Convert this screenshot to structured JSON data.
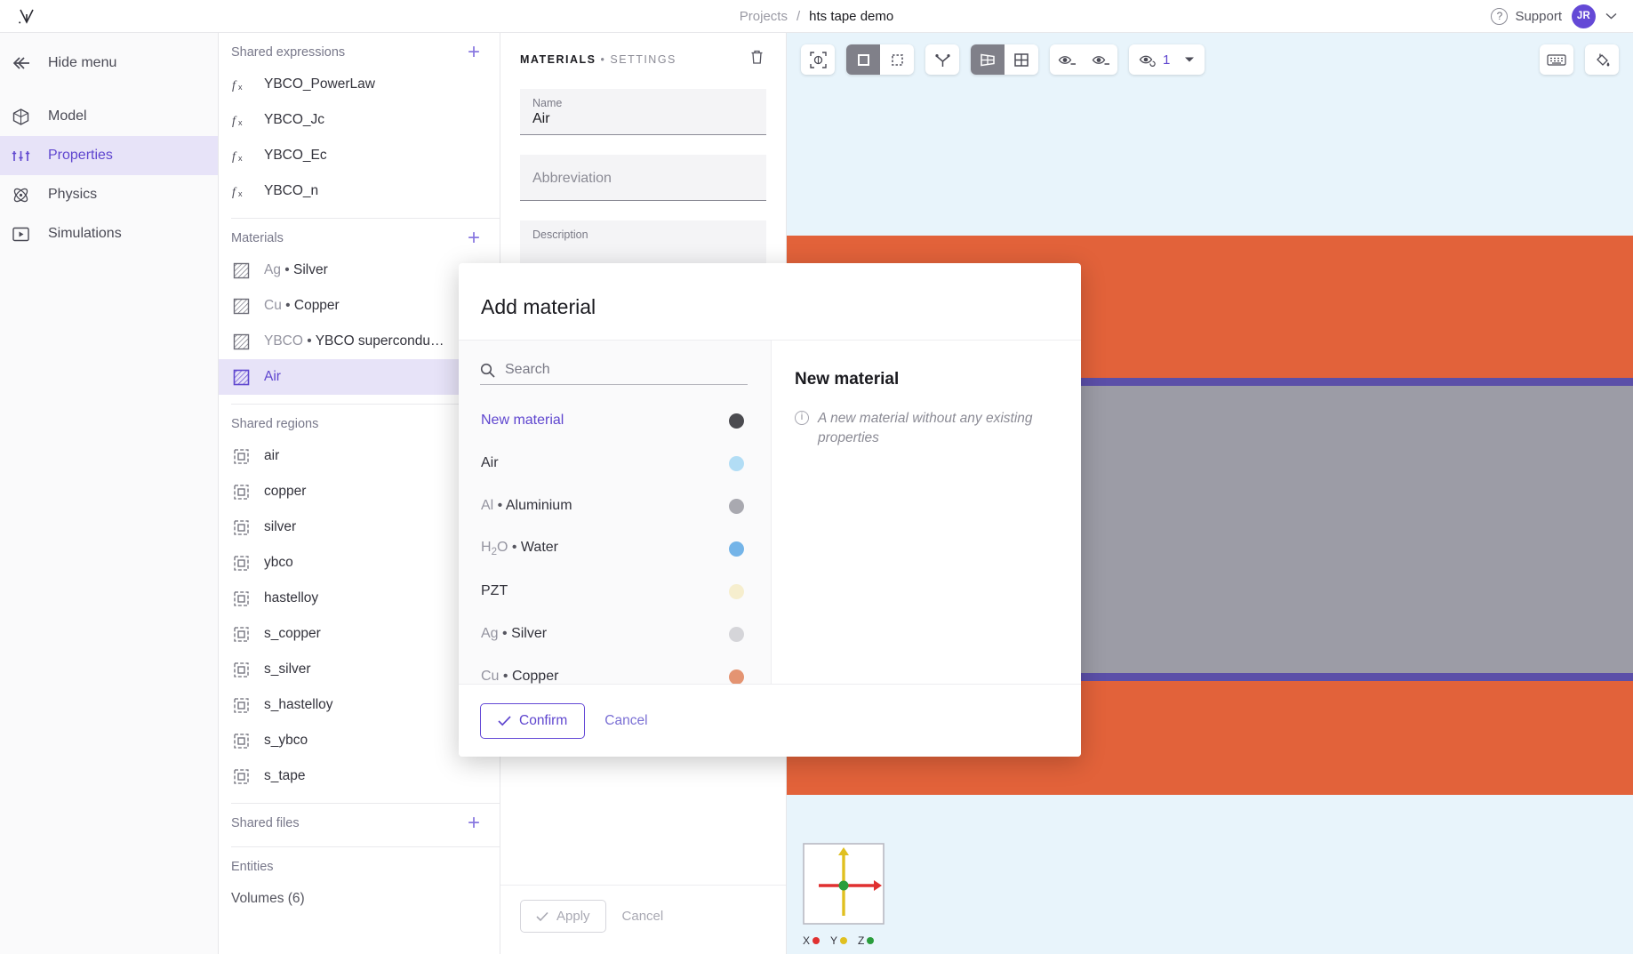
{
  "topbar": {
    "logo_icon": "vector-logo-icon",
    "breadcrumb": {
      "projects": "Projects",
      "separator": "/",
      "current": "hts tape demo"
    },
    "support_label": "Support",
    "help_icon": "question-circle-icon",
    "avatar_initials": "JR",
    "account_caret_icon": "chevron-down-icon"
  },
  "nav": {
    "hide_menu": "Hide menu",
    "items": [
      {
        "label": "Model",
        "icon": "cube-icon",
        "active": false
      },
      {
        "label": "Properties",
        "icon": "sliders-icon",
        "active": true
      },
      {
        "label": "Physics",
        "icon": "atom-icon",
        "active": false
      },
      {
        "label": "Simulations",
        "icon": "play-box-icon",
        "active": false
      }
    ]
  },
  "tree": {
    "sections": [
      {
        "title": "Shared expressions",
        "add_icon": "plus-icon",
        "items": [
          {
            "label": "YBCO_PowerLaw",
            "icon": "fx-icon"
          },
          {
            "label": "YBCO_Jc",
            "icon": "fx-icon"
          },
          {
            "label": "YBCO_Ec",
            "icon": "fx-icon"
          },
          {
            "label": "YBCO_n",
            "icon": "fx-icon"
          }
        ]
      },
      {
        "title": "Materials",
        "add_icon": "plus-icon",
        "items": [
          {
            "symbol": "Ag",
            "label": "Silver",
            "icon": "hatch-square-icon",
            "selected": false
          },
          {
            "symbol": "Cu",
            "label": "Copper",
            "icon": "hatch-square-icon",
            "selected": false
          },
          {
            "symbol": "YBCO",
            "label": "YBCO supercondu…",
            "icon": "hatch-square-icon",
            "selected": false
          },
          {
            "symbol": "",
            "label": "Air",
            "icon": "hatch-square-icon",
            "selected": true
          }
        ]
      },
      {
        "title": "Shared regions",
        "items": [
          {
            "label": "air",
            "icon": "region-icon"
          },
          {
            "label": "copper",
            "icon": "region-icon"
          },
          {
            "label": "silver",
            "icon": "region-icon"
          },
          {
            "label": "ybco",
            "icon": "region-icon"
          },
          {
            "label": "hastelloy",
            "icon": "region-icon"
          },
          {
            "label": "s_copper",
            "icon": "region-icon"
          },
          {
            "label": "s_silver",
            "icon": "region-icon"
          },
          {
            "label": "s_hastelloy",
            "icon": "region-icon"
          },
          {
            "label": "s_ybco",
            "icon": "region-icon"
          },
          {
            "label": "s_tape",
            "icon": "region-icon"
          }
        ]
      },
      {
        "title": "Shared files",
        "add_icon": "plus-icon",
        "items": []
      },
      {
        "title": "Entities",
        "items": [
          {
            "label": "Volumes (6)",
            "icon": ""
          }
        ]
      }
    ]
  },
  "settings": {
    "header_main": "MATERIALS",
    "header_dot": "•",
    "header_sub": "SETTINGS",
    "delete_icon": "trash-icon",
    "fields": [
      {
        "label": "Name",
        "value": "Air",
        "placeholder": ""
      },
      {
        "label": "",
        "value": "",
        "placeholder": "Abbreviation"
      },
      {
        "label": "Description",
        "value": "",
        "placeholder": ""
      }
    ],
    "apply_label": "Apply",
    "apply_icon": "check-icon",
    "cancel_label": "Cancel"
  },
  "viewport": {
    "toolbar": {
      "fit_icon": "fit-to-view-icon",
      "select_box_icon": "select-solid-icon",
      "select_marquee_icon": "select-dashed-icon",
      "axis_icon": "axis-tripod-icon",
      "view_split_icon": "view-perspective-icon",
      "view_grid_icon": "view-grid-icon",
      "hide_icon": "eye-minus-icon",
      "hide_alt_icon": "eye-minus-alt-icon",
      "visibility_level_icon": "eye-refresh-icon",
      "visibility_level_value": "1",
      "visibility_caret_icon": "caret-down-icon",
      "keyboard_icon": "keyboard-icon",
      "appearance_icon": "paint-bucket-icon"
    },
    "axes": {
      "x_label": "X",
      "y_label": "Y",
      "z_label": "Z",
      "x_color": "#e03030",
      "y_color": "#e0c020",
      "z_color": "#2a9d3c"
    },
    "colors": {
      "background": "#e8f4fb",
      "copper": "#e2623a",
      "silver": "#9c9ca6",
      "substrate": "#5b4fa8"
    }
  },
  "modal": {
    "title": "Add material",
    "search": {
      "placeholder": "Search",
      "icon": "search-icon"
    },
    "materials": [
      {
        "symbol": "",
        "label": "New material",
        "color": "#4b4b50",
        "selected": true
      },
      {
        "symbol": "",
        "label": "Air",
        "color": "#b2ddf5",
        "selected": false
      },
      {
        "symbol": "Al",
        "label": "Aluminium",
        "color": "#a9a9b0",
        "selected": false
      },
      {
        "symbol": "H2O",
        "label": "Water",
        "color": "#74b4e8",
        "selected": false
      },
      {
        "symbol": "",
        "label": "PZT",
        "color": "#f6eece",
        "selected": false
      },
      {
        "symbol": "Ag",
        "label": "Silver",
        "color": "#d5d5d9",
        "selected": false
      },
      {
        "symbol": "Cu",
        "label": "Copper",
        "color": "#e49472",
        "selected": false
      }
    ],
    "detail": {
      "title": "New material",
      "info_icon": "info-circle-icon",
      "description": "A new material without any existing properties"
    },
    "confirm_label": "Confirm",
    "confirm_icon": "check-icon",
    "cancel_label": "Cancel"
  }
}
